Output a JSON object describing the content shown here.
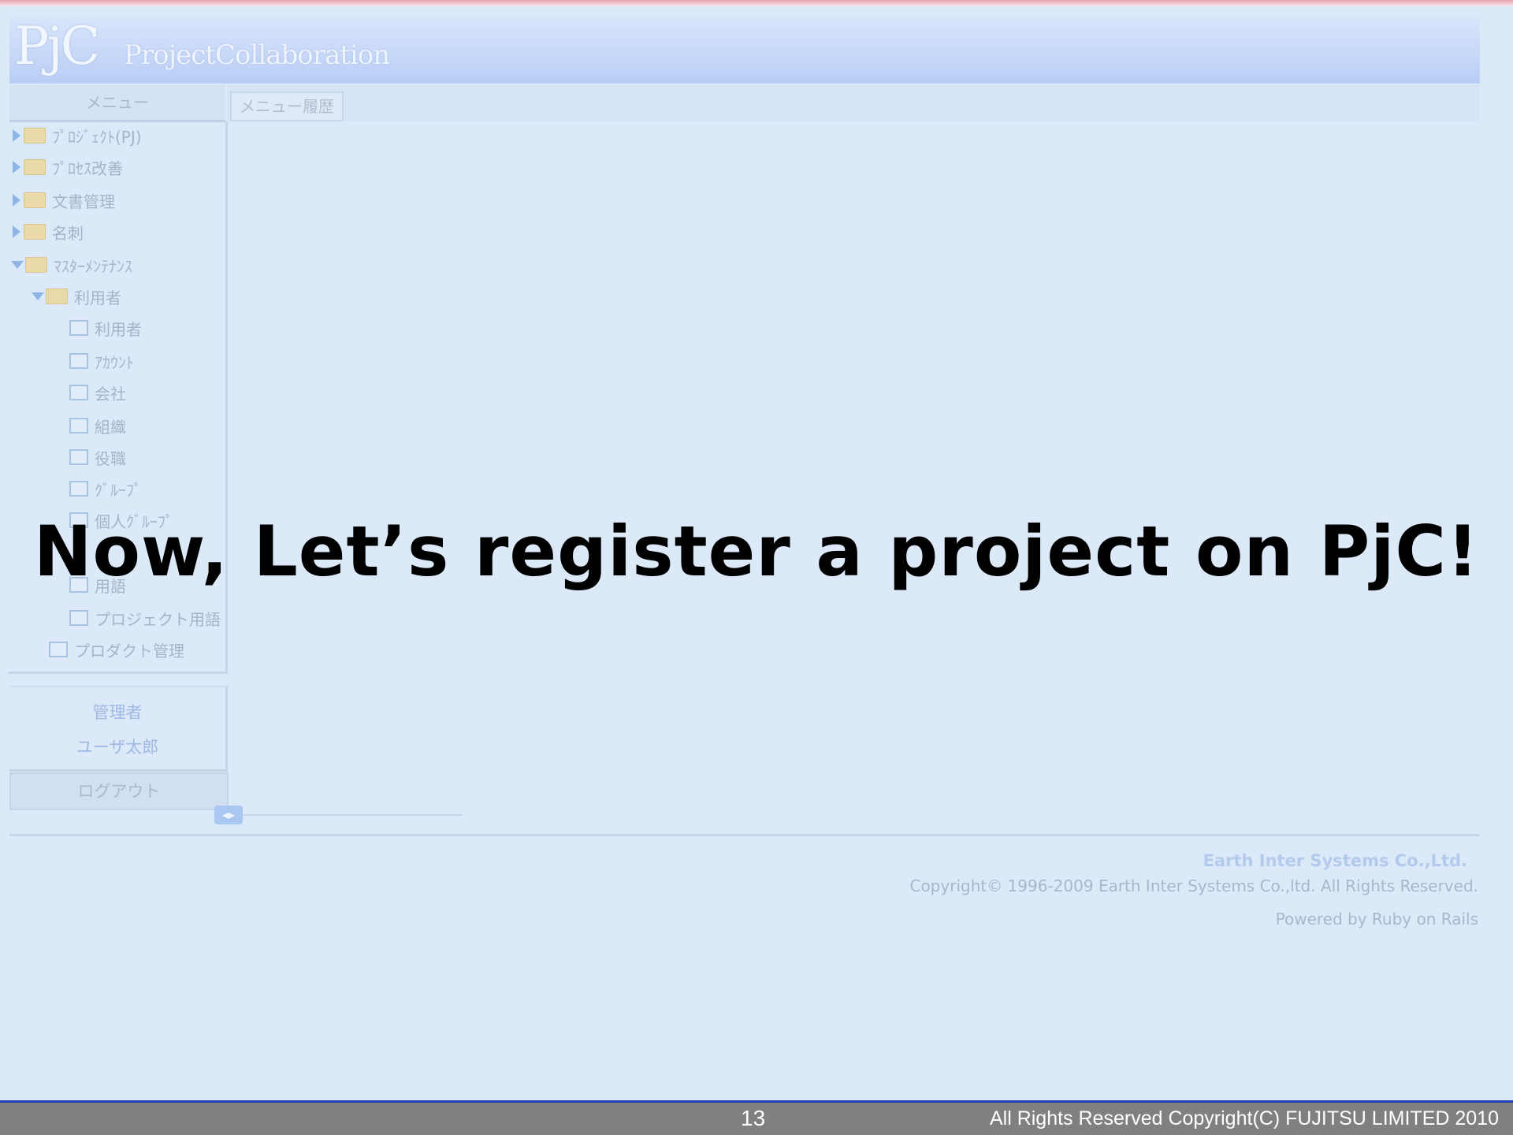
{
  "header": {
    "logo": "PjC",
    "app_title": "ProjectCollaboration"
  },
  "sidebar": {
    "menu_label": "メニュー",
    "items": [
      {
        "label": "ﾌﾟﾛｼﾞｪｸﾄ(PJ)",
        "type": "folder",
        "state": "collapsed"
      },
      {
        "label": "ﾌﾟﾛｾｽ改善",
        "type": "folder",
        "state": "collapsed"
      },
      {
        "label": "文書管理",
        "type": "folder",
        "state": "collapsed"
      },
      {
        "label": "名刺",
        "type": "folder",
        "state": "collapsed"
      },
      {
        "label": "ﾏｽﾀｰﾒﾝﾃﾅﾝｽ",
        "type": "folder",
        "state": "expanded"
      },
      {
        "label": "利用者",
        "type": "folder",
        "state": "expanded"
      },
      {
        "label": "利用者",
        "type": "page"
      },
      {
        "label": "ｱｶｳﾝﾄ",
        "type": "page"
      },
      {
        "label": "会社",
        "type": "page"
      },
      {
        "label": "組織",
        "type": "page"
      },
      {
        "label": "役職",
        "type": "page"
      },
      {
        "label": "ｸﾞﾙｰﾌﾟ",
        "type": "page"
      },
      {
        "label": "個人ｸﾞﾙｰﾌﾟ",
        "type": "page"
      },
      {
        "label": "用語",
        "type": "page"
      },
      {
        "label": "プロジェクト用語",
        "type": "page"
      },
      {
        "label": "プロダクト管理",
        "type": "page"
      }
    ],
    "user_role": "管理者",
    "user_name": "ユーザ太郎",
    "logout_label": "ログアウト"
  },
  "main": {
    "tab_label": "メニュー履歴"
  },
  "footer": {
    "company": "Earth Inter Systems Co.,Ltd.",
    "copyright": "Copyright© 1996-2009 Earth Inter Systems Co.,ltd. All Rights Reserved.",
    "powered": "Powered by Ruby on Rails"
  },
  "overlay": {
    "headline": "Now, Let’s register a project on PjC!"
  },
  "slide": {
    "page_number": "13",
    "copyright": "All Rights Reserved Copyright(C) FUJITSU LIMITED 2010"
  }
}
